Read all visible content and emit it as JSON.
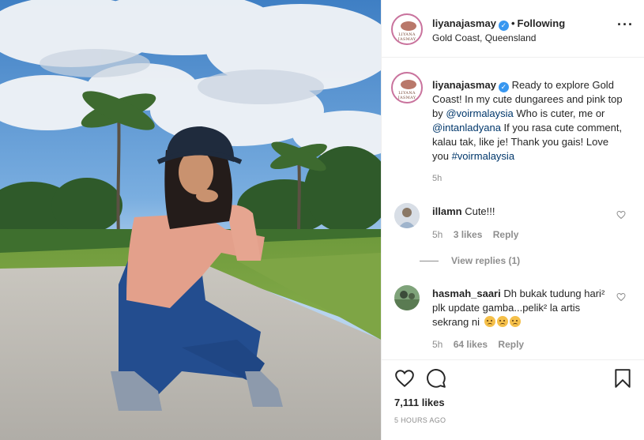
{
  "post": {
    "username": "liyanajasmay",
    "verified": true,
    "separator": "•",
    "following_label": "Following",
    "location": "Gold Coast, Queensland",
    "more_icon": "more-horizontal-icon",
    "avatar_logo_text": "LIYANA JASMAY"
  },
  "caption": {
    "username": "liyanajasmay",
    "text_1": " Ready to explore Gold Coast! In my cute dungarees and pink top by ",
    "mention_1": "@voirmalaysia",
    "text_2": " Who is cuter, me or ",
    "mention_2": "@intanladyana",
    "text_3": " If you rasa cute comment, kalau tak, like je! Thank you gais! Love you ",
    "hashtag": "#voirmalaysia",
    "time": "5h"
  },
  "comments": [
    {
      "username": "illamn",
      "text": "Cute!!!",
      "time": "5h",
      "likes": "3 likes",
      "reply": "Reply",
      "view_replies": "View replies (1)"
    },
    {
      "username": "hasmah_saari",
      "text": "Dh bukak tudung hari² plk update gamba...pelik² la artis sekrang ni",
      "emojis": [
        "frowning-face",
        "frowning-face",
        "frowning-face"
      ],
      "time": "5h",
      "likes": "64 likes",
      "reply": "Reply"
    }
  ],
  "actions": {
    "like_icon": "heart-icon",
    "comment_icon": "comment-icon",
    "save_icon": "bookmark-icon",
    "likes_count": "7,111 likes",
    "timestamp": "5 HOURS AGO"
  },
  "colors": {
    "link": "#00376b",
    "verified": "#3897f0",
    "muted": "#8e8e8e",
    "text": "#262626"
  }
}
